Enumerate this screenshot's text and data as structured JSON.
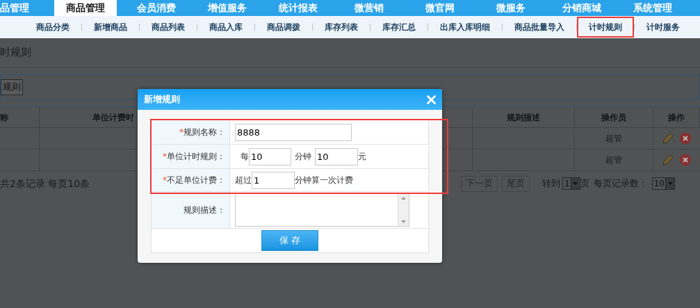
{
  "top_nav": [
    {
      "label": "品管理",
      "selected": false
    },
    {
      "label": "商品管理",
      "selected": true
    },
    {
      "label": "会员消费",
      "selected": false
    },
    {
      "label": "增值服务",
      "selected": false
    },
    {
      "label": "统计报表",
      "selected": false
    },
    {
      "label": "微营销",
      "selected": false
    },
    {
      "label": "微官网",
      "selected": false
    },
    {
      "label": "微服务",
      "selected": false
    },
    {
      "label": "分销商城",
      "selected": false
    },
    {
      "label": "系统管理",
      "selected": false
    }
  ],
  "sub_nav": [
    {
      "label": "商品分类",
      "selected": false
    },
    {
      "label": "新增商品",
      "selected": false
    },
    {
      "label": "商品列表",
      "selected": false
    },
    {
      "label": "商品入库",
      "selected": false
    },
    {
      "label": "商品调拨",
      "selected": false
    },
    {
      "label": "库存列表",
      "selected": false
    },
    {
      "label": "库存汇总",
      "selected": false
    },
    {
      "label": "出库入库明细",
      "selected": false
    },
    {
      "label": "商品批量导入",
      "selected": false
    },
    {
      "label": "计时规则",
      "selected": true
    },
    {
      "label": "计时服务",
      "selected": false
    }
  ],
  "page_title": "时规则",
  "toolbar": {
    "button": "规则"
  },
  "table": {
    "columns": [
      "称",
      "单位计费时",
      "规则描述",
      "操作员",
      "操作"
    ],
    "rows": [
      {
        "operator": "超管"
      },
      {
        "operator": "超管"
      }
    ]
  },
  "pagination": {
    "summary": "共2条记录 每页10条",
    "buttons": [
      "下一页",
      "尾页"
    ],
    "goto_label": "转到",
    "page_select": "1",
    "page_suffix": "页",
    "per_page_label": "每页记录数：",
    "per_page_select": "10"
  },
  "dialog": {
    "title": "新增规则",
    "fields": [
      {
        "kind": "text",
        "required_mark": "*",
        "label": "规则名称：",
        "value": "8888"
      },
      {
        "kind": "rate",
        "required_mark": "*",
        "label": "单位计时规则：",
        "prefix": "每",
        "value": "10",
        "middle": "分钟",
        "value2": "10",
        "suffix": "元"
      },
      {
        "kind": "threshold",
        "required_mark": "*",
        "label": "不足单位计费：",
        "prefix": "超过",
        "value": "1",
        "suffix": "分钟算一次计费"
      },
      {
        "kind": "textarea",
        "label": "规则描述："
      }
    ],
    "save_button": "保 存"
  }
}
